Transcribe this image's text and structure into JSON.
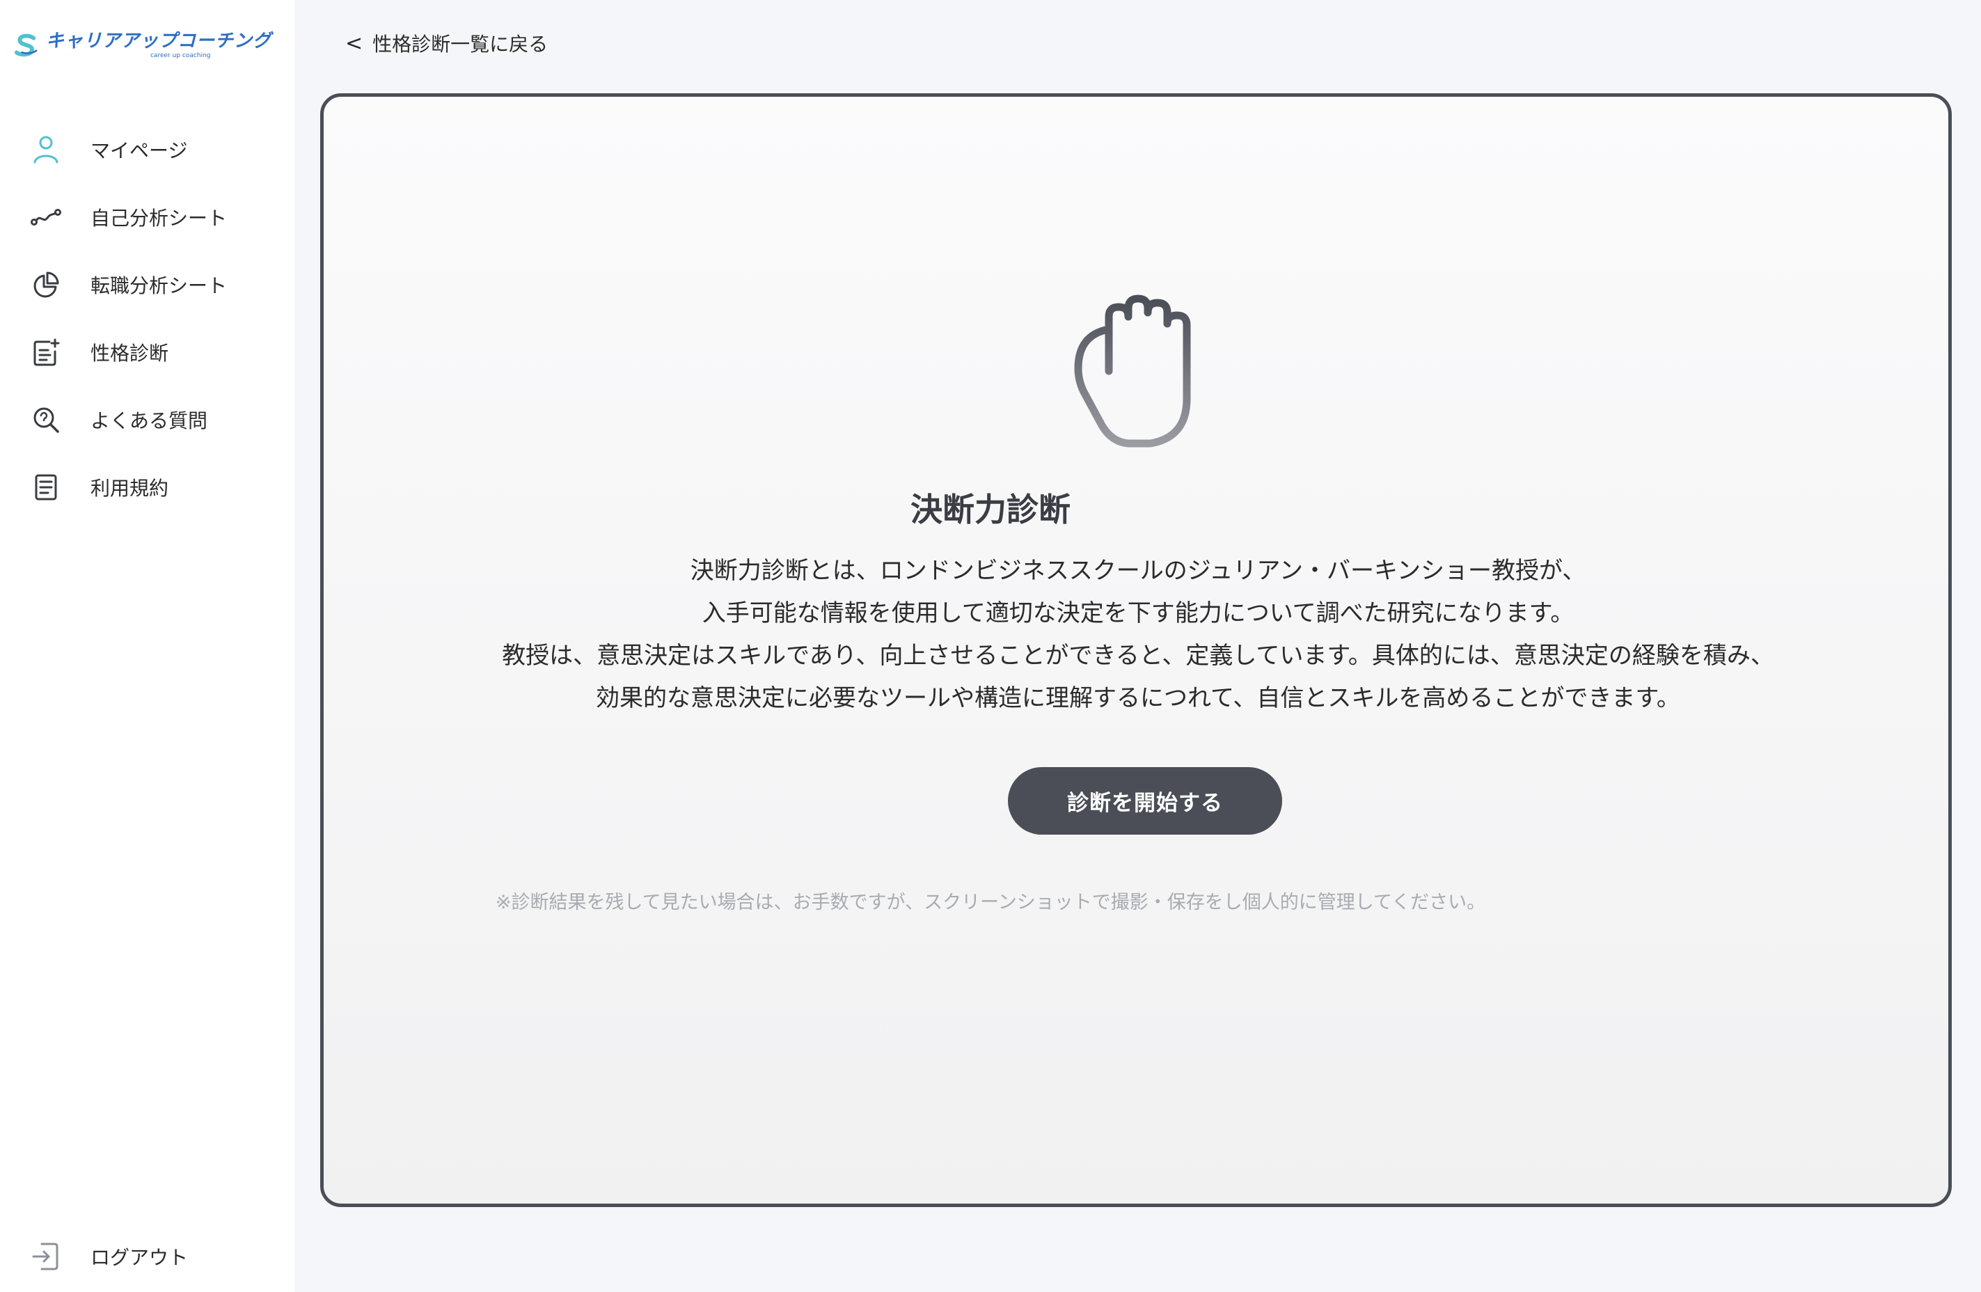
{
  "sidebar": {
    "logo": {
      "text": "キャリアアップコーチング",
      "subtext": "career up coaching"
    },
    "items": [
      {
        "label": "マイページ",
        "icon": "user-icon"
      },
      {
        "label": "自己分析シート",
        "icon": "analytics-path-icon"
      },
      {
        "label": "転職分析シート",
        "icon": "pie-chart-icon"
      },
      {
        "label": "性格診断",
        "icon": "note-add-icon"
      },
      {
        "label": "よくある質問",
        "icon": "search-question-icon"
      },
      {
        "label": "利用規約",
        "icon": "document-icon"
      }
    ],
    "logout": {
      "label": "ログアウト",
      "icon": "logout-icon"
    }
  },
  "header": {
    "back_label": "性格診断一覧に戻る"
  },
  "diagnosis": {
    "icon": "hand-icon",
    "title": "決断力診断",
    "description": [
      "決断力診断とは、ロンドンビジネススクールのジュリアン・バーキンショー教授が、",
      "入手可能な情報を使用して適切な決定を下す能力について調べた研究になります。",
      "教授は、意思決定はスキルであり、向上させることができると、定義しています。具体的には、意思決定の経験を積み、",
      "効果的な意思決定に必要なツールや構造に理解するにつれて、自信とスキルを高めることができます。"
    ],
    "start_button": "診断を開始する",
    "note": "※診断結果を残して見たい場合は、お手数ですが、スクリーンショットで撮影・保存をし個人的に管理してください。"
  },
  "colors": {
    "accent_teal": "#4fc1d2",
    "dark": "#4b4e57",
    "brand_blue": "#2d6ec4"
  }
}
